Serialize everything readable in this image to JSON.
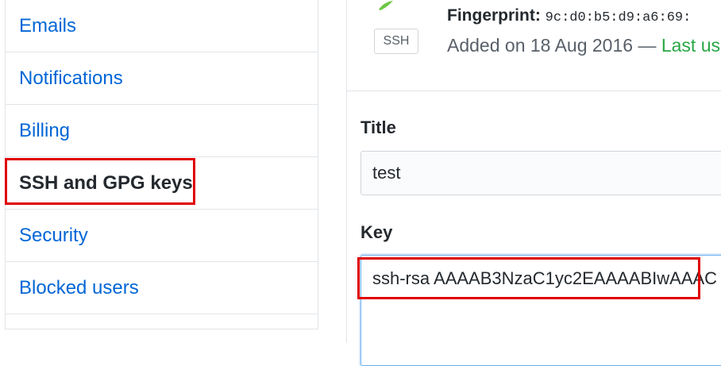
{
  "sidebar": {
    "items": [
      {
        "label": "Emails",
        "selected": false
      },
      {
        "label": "Notifications",
        "selected": false
      },
      {
        "label": "Billing",
        "selected": false
      },
      {
        "label": "SSH and GPG keys",
        "selected": true
      },
      {
        "label": "Security",
        "selected": false
      },
      {
        "label": "Blocked users",
        "selected": false
      }
    ]
  },
  "key_card": {
    "badge": "SSH",
    "fingerprint_label": "Fingerprint:",
    "fingerprint_value": "9c:d0:b5:d9:a6:69:",
    "added_text": "Added on 18 Aug 2016 — ",
    "last_used_text": "Last us",
    "icon": "key-icon"
  },
  "form": {
    "title_label": "Title",
    "title_value": "test",
    "key_label": "Key",
    "key_value": "ssh-rsa AAAAB3NzaC1yc2EAAAABIwAAAC"
  },
  "colors": {
    "link": "#0366d6",
    "highlight": "#e00000",
    "selected_indicator": "#e36209",
    "last_used": "#28a745"
  }
}
